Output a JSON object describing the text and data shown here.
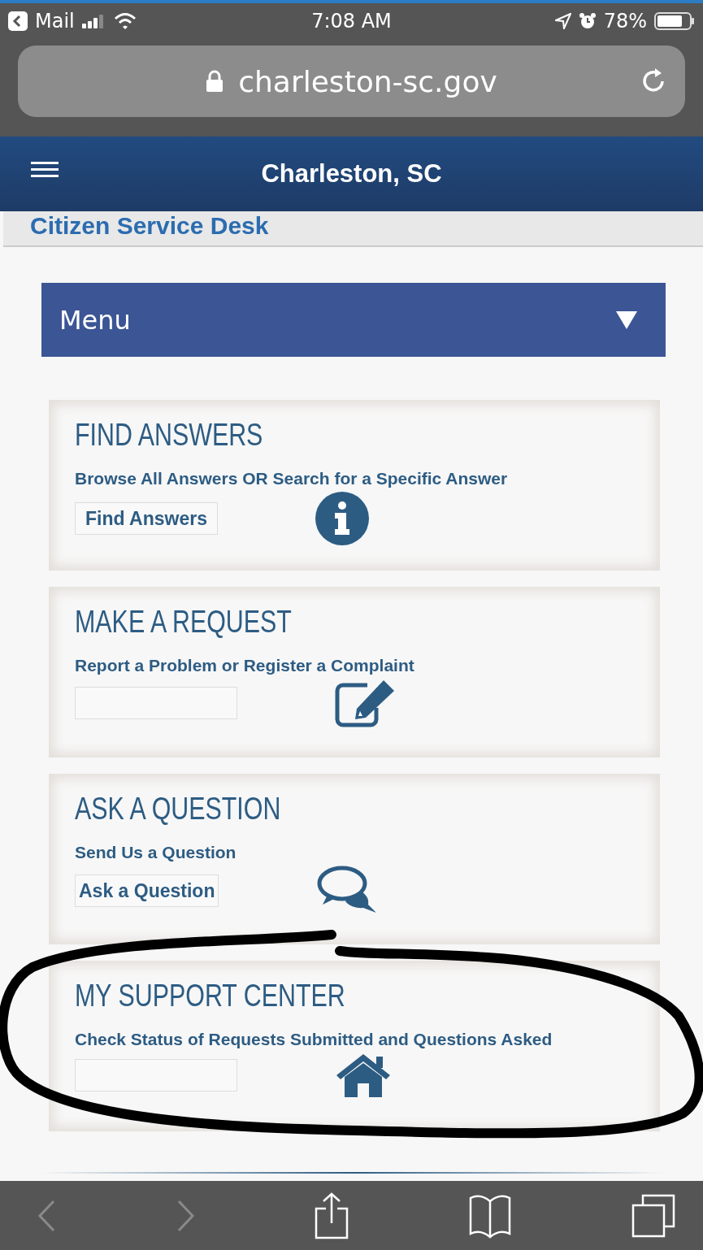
{
  "status_bar": {
    "back_app": "Mail",
    "time": "7:08 AM",
    "battery": "78%"
  },
  "address_bar": {
    "url": "charleston-sc.gov"
  },
  "header": {
    "title": "Charleston, SC"
  },
  "section_title": "Citizen Service Desk",
  "menu": {
    "label": "Menu",
    "expanded": false
  },
  "cards": [
    {
      "title": "FIND ANSWERS",
      "subtitle": "Browse All Answers OR Search for a Specific Answer",
      "button_label": "Find Answers"
    },
    {
      "title": "MAKE A REQUEST",
      "subtitle": "Report a Problem or Register a Complaint"
    },
    {
      "title": "ASK A QUESTION",
      "subtitle": "Send Us a Question",
      "button_label": "Ask a Question"
    },
    {
      "title": "MY SUPPORT CENTER",
      "subtitle": "Check Status of Requests Submitted and Questions Asked"
    }
  ],
  "toolbar": {
    "back": {
      "disabled": true
    },
    "forward": {
      "disabled": true
    }
  }
}
